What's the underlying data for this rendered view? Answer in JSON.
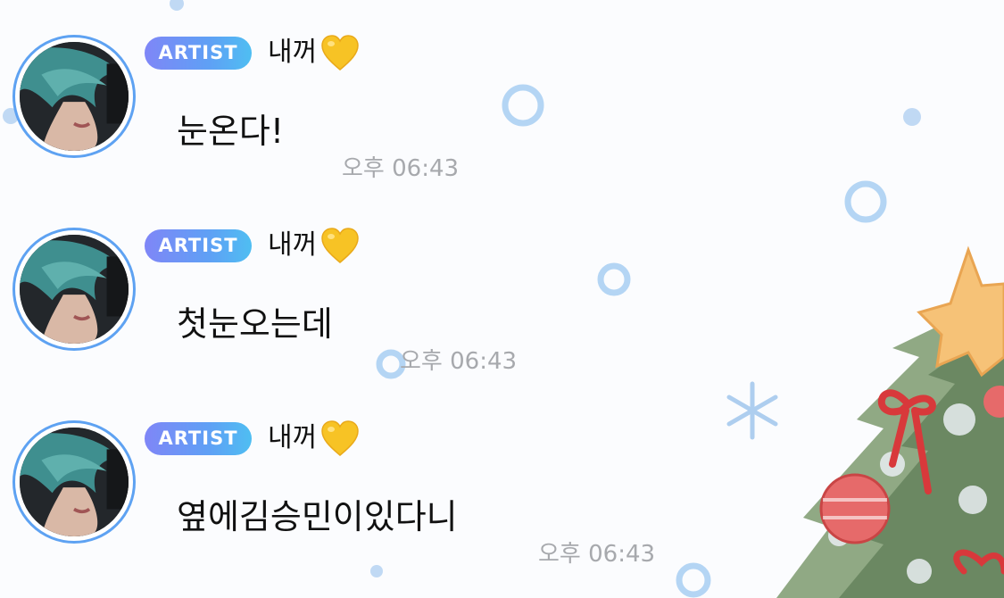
{
  "messages": [
    {
      "badge": "ARTIST",
      "sender": "내꺼",
      "text": "눈온다!",
      "time": "오후 06:43"
    },
    {
      "badge": "ARTIST",
      "sender": "내꺼",
      "text": "첫눈오는데",
      "time": "오후 06:43"
    },
    {
      "badge": "ARTIST",
      "sender": "내꺼",
      "text": "옆에김승민이있다니",
      "time": "오후 06:43"
    }
  ],
  "icons": {
    "sender_emoji": "yellow-heart-icon",
    "avatar": "profile-photo"
  },
  "colors": {
    "badge_gradient_start": "#7f86f7",
    "badge_gradient_end": "#4fbef2",
    "avatar_ring": "#5ea2f2",
    "timestamp": "#a7a9ad",
    "text": "#111111",
    "heart": "#f7c325"
  }
}
